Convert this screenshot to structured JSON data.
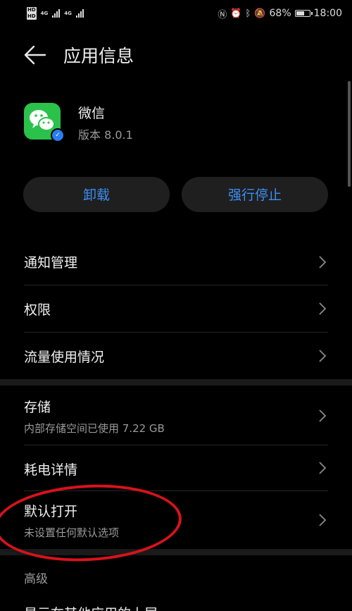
{
  "status_bar": {
    "net1": "HD",
    "net2": "HD",
    "gen1": "4G",
    "gen2": "4G",
    "battery": "68%",
    "battery_level": 0.68,
    "time": "18:00",
    "icons": [
      "nfc-icon",
      "alarm-icon",
      "bluetooth-icon",
      "mute-icon"
    ]
  },
  "header": {
    "title": "应用信息"
  },
  "app": {
    "name": "微信",
    "version": "版本 8.0.1",
    "icon_color": "#2bc24b",
    "badge_color": "#2a7df0"
  },
  "buttons": {
    "uninstall": "卸载",
    "force_stop": "强行停止",
    "accent": "#3d8ef5"
  },
  "settings": {
    "notifications": "通知管理",
    "permissions": "权限",
    "data_usage": "流量使用情况",
    "storage": "存储",
    "storage_sub": "内部存储空间已使用 7.22 GB",
    "battery_details": "耗电详情",
    "open_by_default": "默认打开",
    "open_by_default_sub": "未设置任何默认选项",
    "advanced_label": "高级",
    "overlay_partial": "显示在其他应用的上层"
  }
}
